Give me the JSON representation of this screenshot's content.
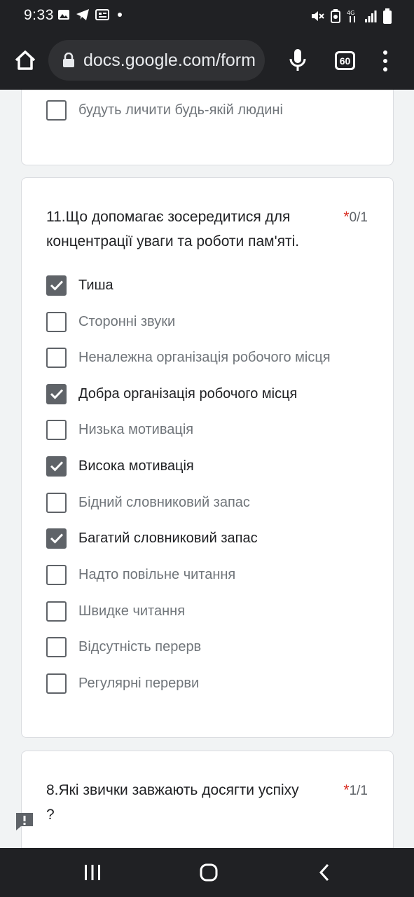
{
  "status_bar": {
    "time": "9:33",
    "left_icons": [
      "image-icon",
      "telegram-icon",
      "news-icon",
      "dot-icon"
    ],
    "right_icons": [
      "mute-icon",
      "battery-saver-icon",
      "data-icon",
      "signal-icon",
      "battery-icon"
    ]
  },
  "browser": {
    "url": "docs.google.com/form",
    "tab_count": "60"
  },
  "prev_question": {
    "last_option": {
      "label": "будуть личити будь-якій людині",
      "checked": false
    }
  },
  "question_11": {
    "title": "11.Що допомагає зосередитися для концентрації уваги та роботи пам'яті.",
    "required_mark": "*",
    "score": "0/1",
    "options": [
      {
        "label": "Тиша",
        "checked": true
      },
      {
        "label": "Сторонні звуки",
        "checked": false
      },
      {
        "label": "Неналежна організація робочого місця",
        "checked": false
      },
      {
        "label": "Добра організація робочого місця",
        "checked": true
      },
      {
        "label": "Низька мотивація",
        "checked": false
      },
      {
        "label": "Висока мотивація",
        "checked": true
      },
      {
        "label": "Бідний словниковий запас",
        "checked": false
      },
      {
        "label": "Багатий словниковий запас",
        "checked": true
      },
      {
        "label": "Надто повільне читання",
        "checked": false
      },
      {
        "label": "Швидке читання",
        "checked": false
      },
      {
        "label": "Відсутність перерв",
        "checked": false
      },
      {
        "label": "Регулярні перерви",
        "checked": false
      }
    ]
  },
  "question_8": {
    "title_line1": "8.Які звички завжають досягти успіху",
    "title_line2": "?",
    "required_mark": "*",
    "score": "1/1"
  },
  "colors": {
    "checkbox_checked": "#5f6368",
    "required_star": "#d93025",
    "chrome_dark": "#202124"
  }
}
